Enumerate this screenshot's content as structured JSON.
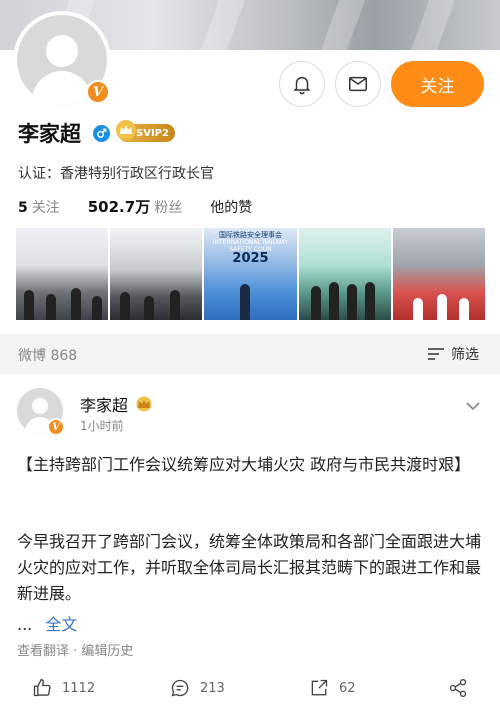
{
  "profile": {
    "name": "李家超",
    "badge_level": "SVIP2",
    "verification": "认证：香港特别行政区行政长官",
    "following_count": "5",
    "following_label": "关注",
    "followers_count": "502.7万",
    "followers_label": "粉丝",
    "likes_label": "他的赞",
    "follow_button": "关注",
    "verified_glyph": "V"
  },
  "photos": {
    "p3_line1": "国际铁路安全理事会",
    "p3_line2": "INTERNATIONAL RAILWAY SAFETY COUN",
    "p3_year": "2025"
  },
  "feed": {
    "weibo_count": "微博 868",
    "filter_label": "筛选"
  },
  "post": {
    "author": "李家超",
    "time": "1小时前",
    "title": "【主持跨部门工作会议统筹应对大埔火灾 政府与市民共渡时艰】",
    "body": "今早我召开了跨部门会议，统筹全体政策局和各部门全面跟进大埔火灾的应对工作，并听取全体司局长汇报其范畴下的跟进工作和最新进展。",
    "ellipsis": "...",
    "full_text_link": "全文",
    "translate_history": "查看翻译 · 编辑历史",
    "likes": "1112",
    "comments": "213",
    "reposts": "62"
  },
  "colors": {
    "accent_orange": "#ff8c17",
    "link_blue": "#3a75c4",
    "verified_blue": "#1a8fe0"
  }
}
